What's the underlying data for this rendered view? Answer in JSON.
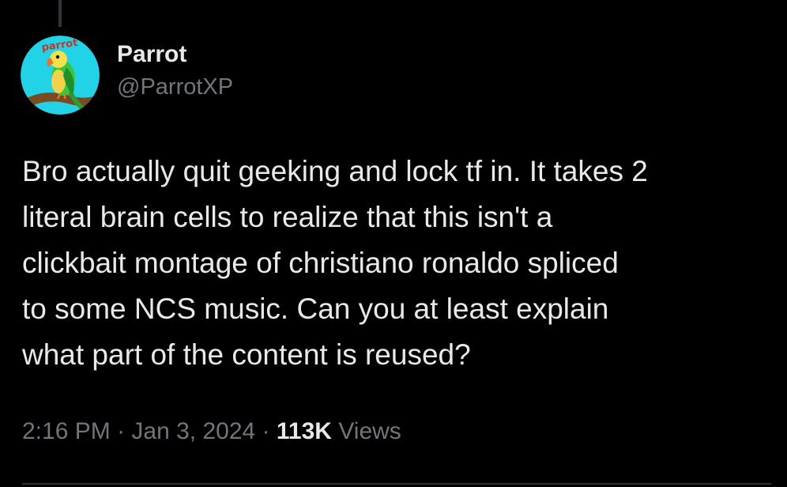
{
  "author": {
    "display_name": "Parrot",
    "handle": "@ParrotXP",
    "avatar_logo_text": "parrot"
  },
  "tweet": {
    "lines": [
      "Bro actually quit geeking and lock tf in. It takes 2",
      "literal brain cells to realize that this isn't a",
      "clickbait montage of christiano ronaldo spliced",
      "to some NCS music. Can you at least explain",
      "what part of the content is reused?"
    ]
  },
  "meta": {
    "time": "2:16 PM",
    "separator": "·",
    "date": "Jan 3, 2024",
    "views_count": "113K",
    "views_label": "Views"
  },
  "colors": {
    "background": "#000000",
    "primary_text": "#e7e9ea",
    "secondary_text": "#71767b",
    "divider": "#2f3336"
  },
  "icons": {
    "avatar": "parrot-logo-avatar"
  }
}
